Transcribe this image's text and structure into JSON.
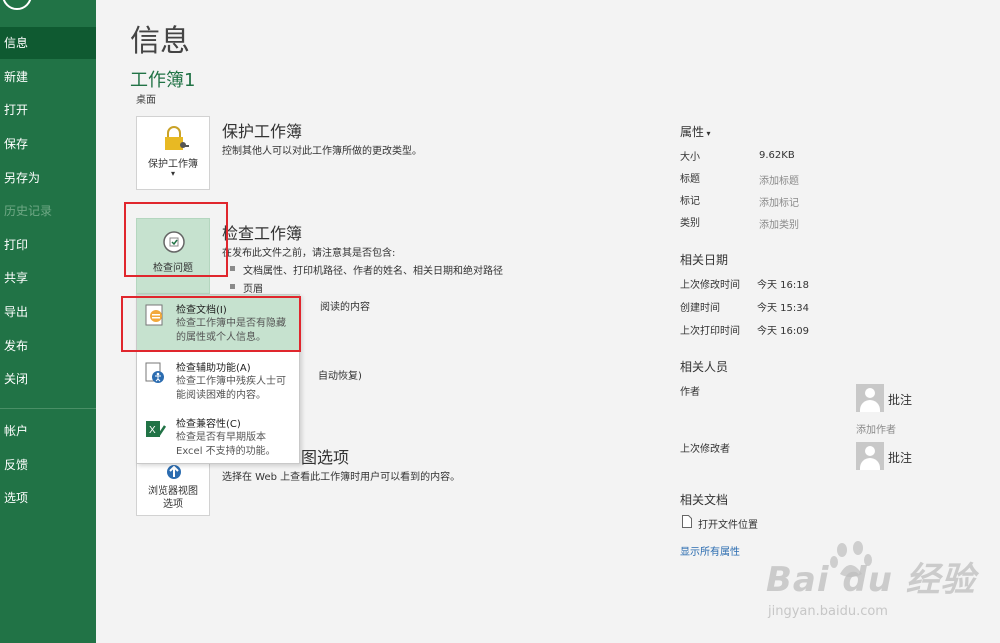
{
  "sidebar": {
    "items": [
      {
        "label": "信息"
      },
      {
        "label": "新建"
      },
      {
        "label": "打开"
      },
      {
        "label": "保存"
      },
      {
        "label": "另存为"
      },
      {
        "label": "历史记录"
      },
      {
        "label": "打印"
      },
      {
        "label": "共享"
      },
      {
        "label": "导出"
      },
      {
        "label": "发布"
      },
      {
        "label": "关闭"
      },
      {
        "label": "帐户"
      },
      {
        "label": "反馈"
      },
      {
        "label": "选项"
      }
    ]
  },
  "page": {
    "title": "信息",
    "workbook_name": "工作簿1",
    "workbook_location": "桌面"
  },
  "protect": {
    "button_label": "保护工作簿",
    "title": "保护工作簿",
    "desc": "控制其他人可以对此工作簿所做的更改类型。"
  },
  "inspect": {
    "button_label": "检查问题",
    "title": "检查工作簿",
    "intro": "在发布此文件之前，请注意其是否包含:",
    "bullets": [
      "文档属性、打印机路径、作者的姓名、相关日期和绝对路径",
      "页眉",
      "阅读的内容"
    ]
  },
  "manage": {
    "title_tail": "",
    "desc_tail": "自动恢复)"
  },
  "browser": {
    "button_label_1": "浏览器视图",
    "button_label_2": "选项",
    "title_tail": "图选项",
    "desc": "选择在 Web 上查看此工作簿时用户可以看到的内容。"
  },
  "menu": {
    "items": [
      {
        "title": "检查文档(I)",
        "desc": "检查工作簿中是否有隐藏的属性或个人信息。",
        "icon": "inspect-document-icon"
      },
      {
        "title": "检查辅助功能(A)",
        "desc": "检查工作簿中残疾人士可能阅读困难的内容。",
        "icon": "accessibility-icon"
      },
      {
        "title": "检查兼容性(C)",
        "desc": "检查是否有早期版本 Excel 不支持的功能。",
        "icon": "compatibility-icon"
      }
    ]
  },
  "properties": {
    "header": "属性",
    "rows": [
      {
        "label": "大小",
        "value": "9.62KB"
      },
      {
        "label": "标题",
        "value": "添加标题"
      },
      {
        "label": "标记",
        "value": "添加标记"
      },
      {
        "label": "类别",
        "value": "添加类别"
      }
    ],
    "dates_header": "相关日期",
    "dates": [
      {
        "label": "上次修改时间",
        "value": "今天 16:18"
      },
      {
        "label": "创建时间",
        "value": "今天 15:34"
      },
      {
        "label": "上次打印时间",
        "value": "今天 16:09"
      }
    ],
    "people_header": "相关人员",
    "author_label": "作者",
    "author_name": "批注",
    "add_author": "添加作者",
    "last_modified_by_label": "上次修改者",
    "last_modified_by_name": "批注",
    "docs_header": "相关文档",
    "open_location": "打开文件位置",
    "show_all": "显示所有属性"
  },
  "watermark": {
    "main": "Bai du 经验",
    "sub": "jingyan.baidu.com"
  },
  "colors": {
    "sidebar": "#217346",
    "sidebar_active": "#0f5a31",
    "accent_green": "#217346",
    "highlight_red": "#e0262d",
    "link_blue": "#2b6cb0"
  }
}
